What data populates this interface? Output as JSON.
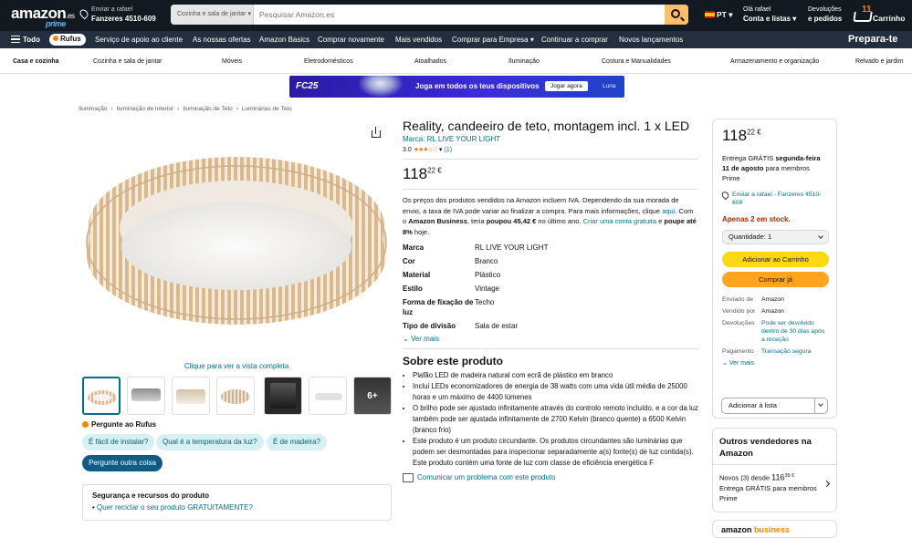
{
  "header": {
    "logo": "amazon",
    "logo_tld": ".es",
    "logo_prime": "prime",
    "deliver_line1": "Enviar a rafael",
    "deliver_line2": "Fanzeres 4510-609",
    "search_category": "Cozinha e sala de jantar",
    "search_placeholder": "Pesquisar Amazon.es",
    "language": "PT",
    "account_line1": "Olá rafael",
    "account_line2": "Conta e listas",
    "orders_line1": "Devoluções",
    "orders_line2": "e pedidos",
    "cart_count": "11",
    "cart_label": "Carrinho"
  },
  "nav": {
    "all": "Todo",
    "rufus": "Rufus",
    "items": [
      "Serviço de apoio ao cliente",
      "As nossas ofertas",
      "Amazon Basics",
      "Comprar novamente",
      "Mais vendidos",
      "Comprar para Empresa",
      "Continuar a comprar",
      "Novos lançamentos"
    ],
    "promo": "Prepara-te"
  },
  "categories": [
    "Casa e cozinha",
    "Cozinha e sala de jantar",
    "Móveis",
    "Eletrodomésticos",
    "Atoalhados",
    "Iluminação",
    "Costura e Manualidades",
    "Armazenamento e organização",
    "Relvado e jardim"
  ],
  "banner": {
    "logo": "FC25",
    "text": "Joga em todos os teus dispositivos",
    "button": "Jogar agora",
    "right": "Luna"
  },
  "breadcrumb": [
    "Iluminação",
    "›",
    "Iluminação de Interior",
    "›",
    "Iluminação de Teto",
    "›",
    "Luminárias de Teto"
  ],
  "gallery": {
    "full_view": "Clique para ver a vista completa",
    "more_label": "6+"
  },
  "rufus_section": {
    "title": "Pergunte ao Rufus",
    "chips": [
      "É fácil de instalar?",
      "Qual é a temperatura da luz?",
      "É de madeira?"
    ],
    "ask_button": "Pergunte outra coisa"
  },
  "safety": {
    "title": "Segurança e recursos do produto",
    "link": "Quer reciclar o seu produto GRATUITAMENTE?"
  },
  "product": {
    "title": "Reality, candeeiro de teto, montagem incl. 1 x LED",
    "brand": "Marca: RL LIVE YOUR LIGHT",
    "rating": "3.0",
    "stars": "★★★☆☆",
    "reviews": "(1)",
    "price_whole": "118",
    "price_fraction": "22 €",
    "vat_text_1": "Os preços dos produtos vendidos na Amazon incluem IVA. Dependendo da sua morada de envio, a taxa de IVA pode variar ao finalizar a compra. Para mais informações, clique ",
    "vat_link": "aqui",
    "vat_text_2": ". Com o ",
    "vat_business": "Amazon Business",
    "vat_text_3": ", teria ",
    "vat_saved": "poupou 45,42 €",
    "vat_text_4": " no último ano. ",
    "vat_create": "Criar uma conta gratuita",
    "vat_text_5": " e ",
    "vat_save": "poupe até 8%",
    "vat_text_6": " hoje.",
    "specs": [
      {
        "k": "Marca",
        "v": "RL LIVE YOUR LIGHT"
      },
      {
        "k": "Cor",
        "v": "Branco"
      },
      {
        "k": "Material",
        "v": "Plástico"
      },
      {
        "k": "Estilo",
        "v": "Vintage"
      },
      {
        "k": "Forma de fixação de luz",
        "v": "Techo"
      },
      {
        "k": "Tipo de divisão",
        "v": "Sala de estar"
      }
    ],
    "see_more": "Ver mais",
    "about_title": "Sobre este produto",
    "bullets": [
      "Plafão LED de madeira natural com ecrã de plástico em branco",
      "Inclui LEDs economizadores de energia de 38 watts com uma vida útil média de 25000 horas e um máximo de 4400 lúmenes",
      "O brilho pode ser ajustado infinitamente através do controlo remoto incluído, e a cor da luz também pode ser ajustada infinitamente de 2700 Kelvin (branco quente) a 6500 Kelvin (branco frio)",
      "Este produto é um produto circundante. Os produtos circundantes são luminárias que podem ser desmontadas para inspecionar separadamente a(s) fonte(s) de luz contida(s). Este produto contém uma fonte de luz com classe de eficiência energética F"
    ],
    "report": "Comunicar um problema com este produto"
  },
  "buybox": {
    "price_whole": "118",
    "price_fraction": "22 €",
    "delivery_1": "Entrega GRÁTIS ",
    "delivery_date": "segunda-feira 11 de agosto",
    "delivery_2": " para membros Prime",
    "location": "Enviar a rafael - Fanzeres 4510-609",
    "stock": "Apenas 2 em stock.",
    "quantity": "Quantidade:  1",
    "add_cart": "Adicionar ao Carrinho",
    "buy_now": "Comprar já",
    "seller_rows": [
      {
        "k": "Enviado de",
        "v": "Amazon"
      },
      {
        "k": "Vendido por",
        "v": "Amazon"
      },
      {
        "k": "Devoluções",
        "v": "Pode ser devolvido dentro de 30 dias após a receção"
      },
      {
        "k": "Pagamento",
        "v": "Transação segura"
      }
    ],
    "see_more": "Ver mais",
    "add_list": "Adicionar à lista"
  },
  "other_sellers": {
    "title": "Outros vendedores na Amazon",
    "line1": "Novos (3) desde ",
    "price": "116",
    "price_frac": "39 €",
    "line2": "Entrega GRÁTIS para membros Prime"
  },
  "business": {
    "a": "amazon",
    "b": " business"
  },
  "colors": {
    "header": "#131921",
    "nav": "#232f3e",
    "accent": "#febd69",
    "link": "#007185",
    "stock": "#b12704"
  }
}
